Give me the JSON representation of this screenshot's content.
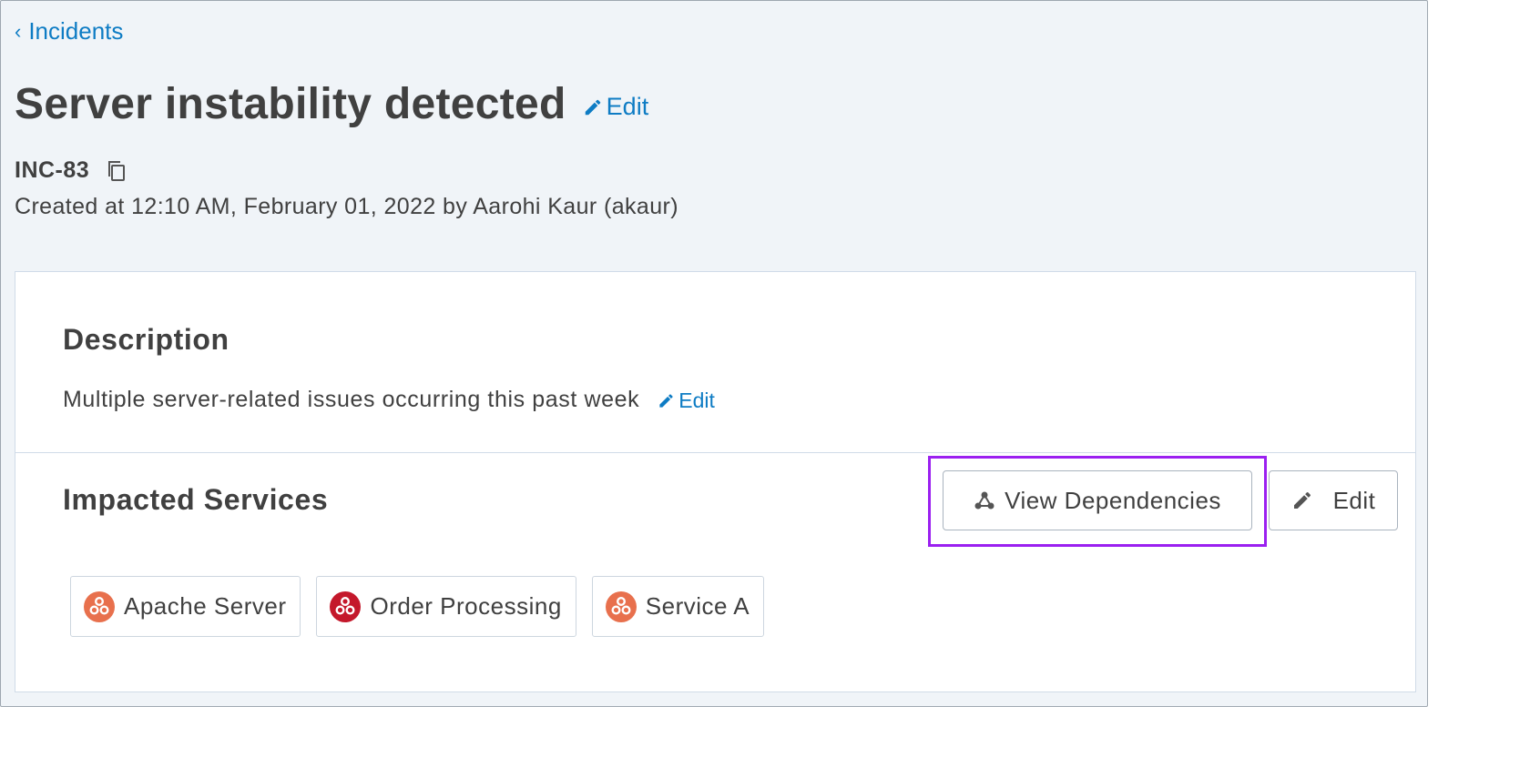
{
  "breadcrumb": {
    "label": "Incidents"
  },
  "incident": {
    "title": "Server instability detected",
    "title_edit_label": "Edit",
    "id": "INC-83",
    "created_line": "Created at 12:10 AM, February 01, 2022 by Aarohi Kaur (akaur)"
  },
  "description": {
    "heading": "Description",
    "text": "Multiple server-related issues occurring this past week",
    "edit_label": "Edit"
  },
  "impacted_services": {
    "heading": "Impacted Services",
    "view_dependencies_label": "View Dependencies",
    "edit_label": "Edit",
    "services": [
      {
        "name": "Apache Server",
        "icon": "service-icon",
        "color": "#e8704d"
      },
      {
        "name": "Order Processing",
        "icon": "service-icon",
        "color": "#c4182b"
      },
      {
        "name": "Service A",
        "icon": "service-icon",
        "color": "#e8704d"
      }
    ]
  },
  "colors": {
    "link": "#0e7cc4",
    "highlight": "#9b20f0",
    "page_background": "#f0f4f8"
  }
}
